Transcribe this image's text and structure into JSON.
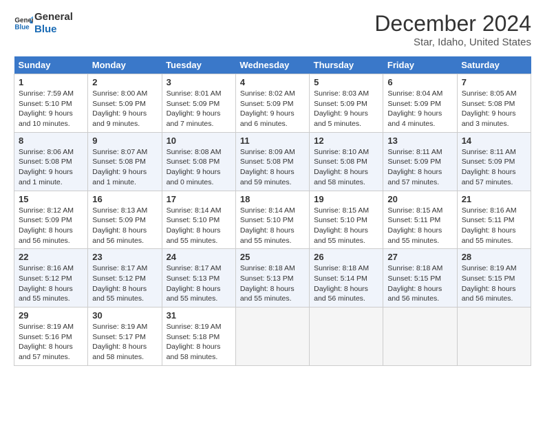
{
  "header": {
    "logo_line1": "General",
    "logo_line2": "Blue",
    "month": "December 2024",
    "location": "Star, Idaho, United States"
  },
  "weekdays": [
    "Sunday",
    "Monday",
    "Tuesday",
    "Wednesday",
    "Thursday",
    "Friday",
    "Saturday"
  ],
  "weeks": [
    [
      {
        "day": "1",
        "info": "Sunrise: 7:59 AM\nSunset: 5:10 PM\nDaylight: 9 hours and 10 minutes."
      },
      {
        "day": "2",
        "info": "Sunrise: 8:00 AM\nSunset: 5:09 PM\nDaylight: 9 hours and 9 minutes."
      },
      {
        "day": "3",
        "info": "Sunrise: 8:01 AM\nSunset: 5:09 PM\nDaylight: 9 hours and 7 minutes."
      },
      {
        "day": "4",
        "info": "Sunrise: 8:02 AM\nSunset: 5:09 PM\nDaylight: 9 hours and 6 minutes."
      },
      {
        "day": "5",
        "info": "Sunrise: 8:03 AM\nSunset: 5:09 PM\nDaylight: 9 hours and 5 minutes."
      },
      {
        "day": "6",
        "info": "Sunrise: 8:04 AM\nSunset: 5:09 PM\nDaylight: 9 hours and 4 minutes."
      },
      {
        "day": "7",
        "info": "Sunrise: 8:05 AM\nSunset: 5:08 PM\nDaylight: 9 hours and 3 minutes."
      }
    ],
    [
      {
        "day": "8",
        "info": "Sunrise: 8:06 AM\nSunset: 5:08 PM\nDaylight: 9 hours and 1 minute."
      },
      {
        "day": "9",
        "info": "Sunrise: 8:07 AM\nSunset: 5:08 PM\nDaylight: 9 hours and 1 minute."
      },
      {
        "day": "10",
        "info": "Sunrise: 8:08 AM\nSunset: 5:08 PM\nDaylight: 9 hours and 0 minutes."
      },
      {
        "day": "11",
        "info": "Sunrise: 8:09 AM\nSunset: 5:08 PM\nDaylight: 8 hours and 59 minutes."
      },
      {
        "day": "12",
        "info": "Sunrise: 8:10 AM\nSunset: 5:08 PM\nDaylight: 8 hours and 58 minutes."
      },
      {
        "day": "13",
        "info": "Sunrise: 8:11 AM\nSunset: 5:09 PM\nDaylight: 8 hours and 57 minutes."
      },
      {
        "day": "14",
        "info": "Sunrise: 8:11 AM\nSunset: 5:09 PM\nDaylight: 8 hours and 57 minutes."
      }
    ],
    [
      {
        "day": "15",
        "info": "Sunrise: 8:12 AM\nSunset: 5:09 PM\nDaylight: 8 hours and 56 minutes."
      },
      {
        "day": "16",
        "info": "Sunrise: 8:13 AM\nSunset: 5:09 PM\nDaylight: 8 hours and 56 minutes."
      },
      {
        "day": "17",
        "info": "Sunrise: 8:14 AM\nSunset: 5:10 PM\nDaylight: 8 hours and 55 minutes."
      },
      {
        "day": "18",
        "info": "Sunrise: 8:14 AM\nSunset: 5:10 PM\nDaylight: 8 hours and 55 minutes."
      },
      {
        "day": "19",
        "info": "Sunrise: 8:15 AM\nSunset: 5:10 PM\nDaylight: 8 hours and 55 minutes."
      },
      {
        "day": "20",
        "info": "Sunrise: 8:15 AM\nSunset: 5:11 PM\nDaylight: 8 hours and 55 minutes."
      },
      {
        "day": "21",
        "info": "Sunrise: 8:16 AM\nSunset: 5:11 PM\nDaylight: 8 hours and 55 minutes."
      }
    ],
    [
      {
        "day": "22",
        "info": "Sunrise: 8:16 AM\nSunset: 5:12 PM\nDaylight: 8 hours and 55 minutes."
      },
      {
        "day": "23",
        "info": "Sunrise: 8:17 AM\nSunset: 5:12 PM\nDaylight: 8 hours and 55 minutes."
      },
      {
        "day": "24",
        "info": "Sunrise: 8:17 AM\nSunset: 5:13 PM\nDaylight: 8 hours and 55 minutes."
      },
      {
        "day": "25",
        "info": "Sunrise: 8:18 AM\nSunset: 5:13 PM\nDaylight: 8 hours and 55 minutes."
      },
      {
        "day": "26",
        "info": "Sunrise: 8:18 AM\nSunset: 5:14 PM\nDaylight: 8 hours and 56 minutes."
      },
      {
        "day": "27",
        "info": "Sunrise: 8:18 AM\nSunset: 5:15 PM\nDaylight: 8 hours and 56 minutes."
      },
      {
        "day": "28",
        "info": "Sunrise: 8:19 AM\nSunset: 5:15 PM\nDaylight: 8 hours and 56 minutes."
      }
    ],
    [
      {
        "day": "29",
        "info": "Sunrise: 8:19 AM\nSunset: 5:16 PM\nDaylight: 8 hours and 57 minutes."
      },
      {
        "day": "30",
        "info": "Sunrise: 8:19 AM\nSunset: 5:17 PM\nDaylight: 8 hours and 58 minutes."
      },
      {
        "day": "31",
        "info": "Sunrise: 8:19 AM\nSunset: 5:18 PM\nDaylight: 8 hours and 58 minutes."
      },
      null,
      null,
      null,
      null
    ]
  ]
}
